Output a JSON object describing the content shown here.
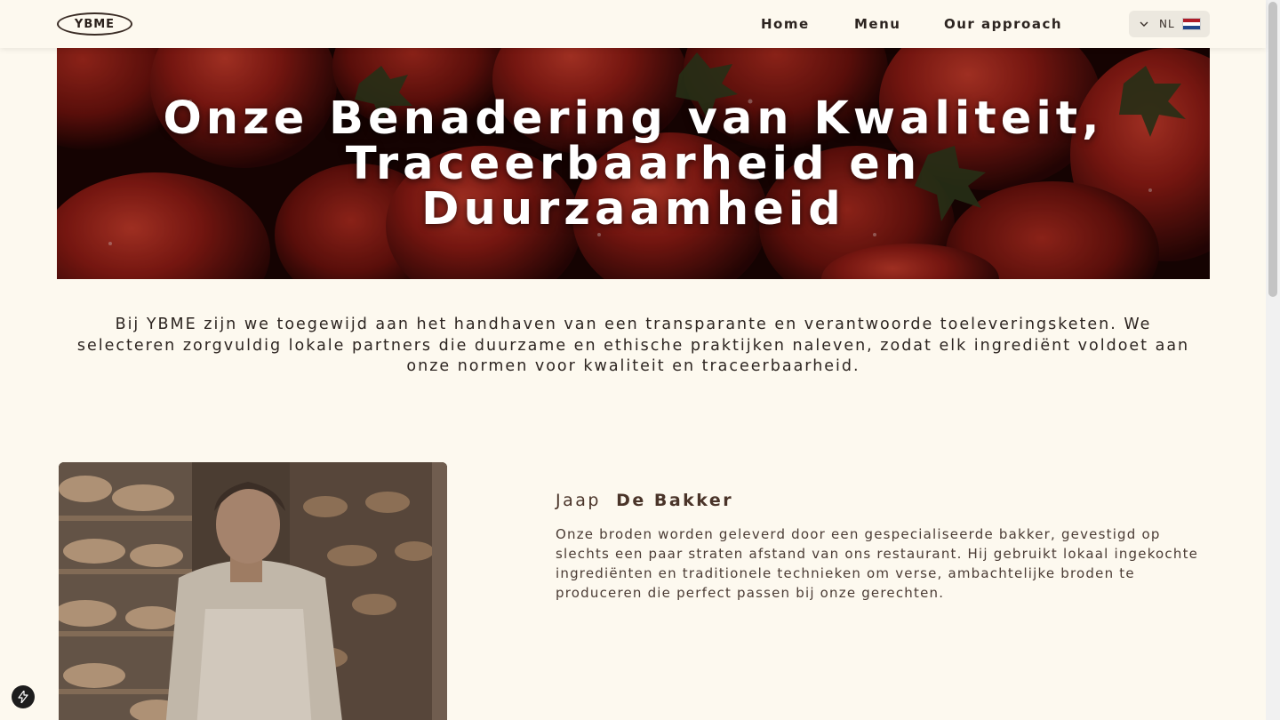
{
  "header": {
    "logo_text": "YBME",
    "nav": [
      {
        "label": "Home"
      },
      {
        "label": "Menu"
      },
      {
        "label": "Our approach"
      }
    ],
    "language": {
      "code": "NL",
      "flag": "netherlands-flag-icon",
      "icon": "chevron-down-icon"
    }
  },
  "hero": {
    "title_lines": [
      "Onze Benadering van Kwaliteit,",
      "Traceerbaarheid en",
      "Duurzaamheid"
    ],
    "background": "tomatoes-photo"
  },
  "intro": {
    "text": "Bij YBME zijn we toegewijd aan het handhaven van een transparante en verantwoorde toeleveringsketen. We selecteren zorgvuldig lokale partners die duurzame en ethische praktijken naleven, zodat elk ingrediënt voldoet aan onze normen voor kwaliteit en traceerbaarheid."
  },
  "supplier": {
    "first_name": "Jaap",
    "last_name": "De Bakker",
    "description": "Onze broden worden geleverd door een gespecialiseerde bakker, gevestigd op slechts een paar straten afstand van ons restaurant. Hij gebruikt lokaal ingekochte ingrediënten en traditionele technieken om verse, ambachtelijke broden te produceren die perfect passen bij onze gerechten.",
    "photo": "baker-photo"
  },
  "colors": {
    "background": "#fdf9ef",
    "text": "#2c2420",
    "accent_brown": "#4a3429",
    "hero_red": "#8a1a14"
  }
}
